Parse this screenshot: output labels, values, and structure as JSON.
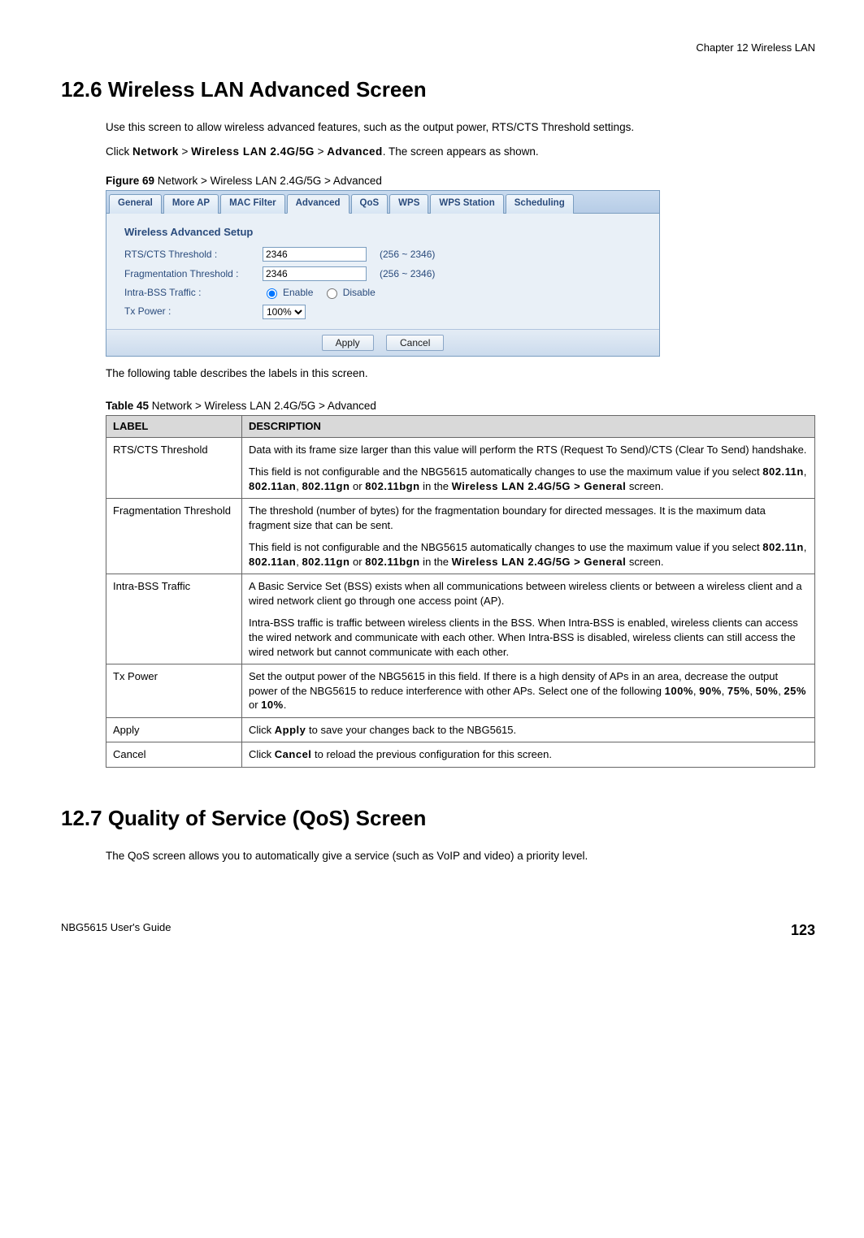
{
  "header": {
    "chapter": "Chapter 12 Wireless LAN"
  },
  "s126": {
    "heading": "12.6  Wireless LAN Advanced Screen",
    "p1": "Use this screen to allow wireless advanced features, such as the output power, RTS/CTS Threshold settings.",
    "p2_a": "Click ",
    "p2_b": "Network",
    "p2_c": " > ",
    "p2_d": "Wireless LAN 2.4G/5G",
    "p2_e": " > ",
    "p2_f": "Advanced",
    "p2_g": ". The screen appears as shown.",
    "fig": {
      "num": "Figure 69",
      "title": "   Network > Wireless LAN 2.4G/5G > Advanced"
    },
    "p3": "The following table describes the labels in this screen."
  },
  "screenshot": {
    "tabs": [
      "General",
      "More AP",
      "MAC Filter",
      "Advanced",
      "QoS",
      "WPS",
      "WPS Station",
      "Scheduling"
    ],
    "active_tab_index": 3,
    "panel_title": "Wireless Advanced Setup",
    "rows": {
      "rts_label": "RTS/CTS Threshold :",
      "rts_value": "2346",
      "rts_hint": "(256 ~ 2346)",
      "frag_label": "Fragmentation Threshold :",
      "frag_value": "2346",
      "frag_hint": "(256 ~ 2346)",
      "intra_label": "Intra-BSS Traffic :",
      "intra_enable": "Enable",
      "intra_disable": "Disable",
      "txp_label": "Tx Power :",
      "txp_value": "100%"
    },
    "buttons": {
      "apply": "Apply",
      "cancel": "Cancel"
    }
  },
  "table45": {
    "caption_num": "Table 45",
    "caption_title": "   Network > Wireless LAN 2.4G/5G > Advanced",
    "head": {
      "label": "LABEL",
      "desc": "DESCRIPTION"
    },
    "rows": [
      {
        "label": "RTS/CTS Threshold",
        "d1": "Data with its frame size larger than this value will perform the RTS (Request To Send)/CTS (Clear To Send) handshake.",
        "d2a": "This field is not configurable and the NBG5615 automatically changes to use the maximum value if you select ",
        "d2b": "802.11n",
        "d2c": ", ",
        "d2d": "802.11an",
        "d2e": ", ",
        "d2f": "802.11gn",
        "d2g": " or ",
        "d2h": "802.11bgn",
        "d2i": " in the ",
        "d2j": "Wireless LAN 2.4G/5G > General",
        "d2k": " screen."
      },
      {
        "label": "Fragmentation Threshold",
        "d1": "The threshold (number of bytes) for the fragmentation boundary for directed messages. It is the maximum data fragment size that can be sent.",
        "d2a": "This field is not configurable and the NBG5615 automatically changes to use the maximum value if you select ",
        "d2b": "802.11n",
        "d2c": ", ",
        "d2d": "802.11an",
        "d2e": ", ",
        "d2f": "802.11gn",
        "d2g": " or ",
        "d2h": "802.11bgn",
        "d2i": " in the ",
        "d2j": "Wireless LAN 2.4G/5G > General",
        "d2k": " screen."
      },
      {
        "label": "Intra-BSS Traffic",
        "d1": "A Basic Service Set (BSS) exists when all communications between wireless clients or between a wireless client and a wired network client go through one access point (AP).",
        "d2": "Intra-BSS traffic is traffic between wireless clients in the BSS. When Intra-BSS is enabled, wireless clients can access the wired network and communicate with each other. When Intra-BSS is disabled, wireless clients can still access the wired network but cannot communicate with each other."
      },
      {
        "label": "Tx Power",
        "d1a": "Set the output power of the NBG5615 in this field. If there is a high density of APs in an area, decrease the output power of the NBG5615 to reduce interference with other APs. Select one of the following ",
        "d1b": "100%",
        "d1c": ", ",
        "d1d": "90%",
        "d1e": ", ",
        "d1f": "75%",
        "d1g": ", ",
        "d1h": "50%",
        "d1i": ", ",
        "d1j": "25%",
        "d1k": " or ",
        "d1l": "10%",
        "d1m": "."
      },
      {
        "label": "Apply",
        "d1a": "Click ",
        "d1b": "Apply",
        "d1c": " to save your changes back to the NBG5615."
      },
      {
        "label": "Cancel",
        "d1a": "Click ",
        "d1b": "Cancel",
        "d1c": " to reload the previous configuration for this screen."
      }
    ]
  },
  "s127": {
    "heading": "12.7  Quality of Service (QoS) Screen",
    "p1": "The QoS screen allows you to automatically give a service (such as VoIP and video) a priority level."
  },
  "footer": {
    "guide": "NBG5615 User's Guide",
    "page": "123"
  }
}
